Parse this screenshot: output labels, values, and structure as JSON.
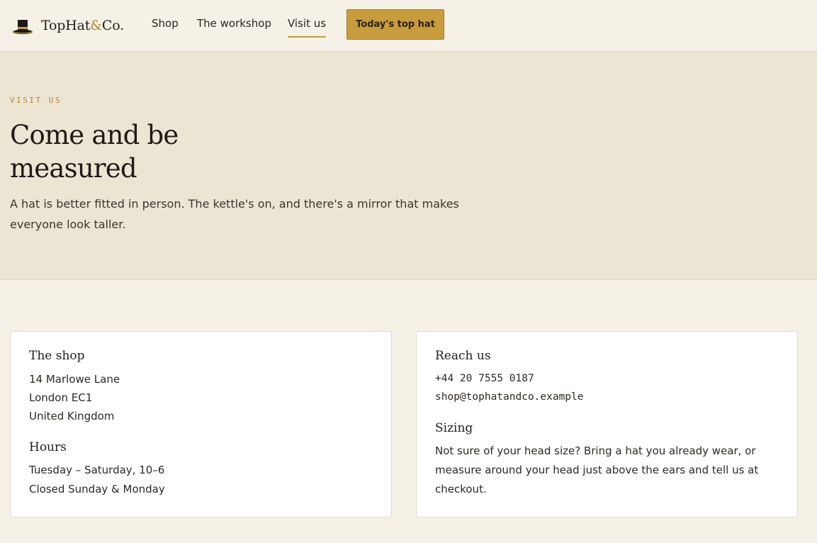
{
  "header": {
    "logo": {
      "icon": "top-hat-icon",
      "text_main": "TopHat",
      "text_amp": "&",
      "text_end": "Co."
    },
    "nav": [
      {
        "label": "Shop",
        "active": false
      },
      {
        "label": "The workshop",
        "active": false
      },
      {
        "label": "Visit us",
        "active": true
      }
    ],
    "cta_label": "Today's top hat"
  },
  "hero": {
    "eyebrow": "VISIT US",
    "title": "Come and be measured",
    "lead": "A hat is better fitted in person. The kettle's on, and there's a mirror that makes everyone look taller."
  },
  "shop_card": {
    "title": "The shop",
    "address": [
      "14 Marlowe Lane",
      "London EC1",
      "United Kingdom"
    ],
    "hours_title": "Hours",
    "hours": [
      "Tuesday – Saturday, 10–6",
      "Closed Sunday & Monday"
    ]
  },
  "reach_card": {
    "title": "Reach us",
    "phone": "+44 20 7555 0187",
    "email": "shop@tophatandco.example",
    "sizing_title": "Sizing",
    "sizing_text": "Not sure of your head size? Bring a hat you already wear, or measure around your head just above the ears and tell us at checkout."
  },
  "colors": {
    "page_bg": "#f6f1e7",
    "hero_bg": "#ede5d4",
    "accent_gold": "#c89b3c",
    "eyebrow_gold": "#b08a2e",
    "text_dark": "#221d18"
  }
}
